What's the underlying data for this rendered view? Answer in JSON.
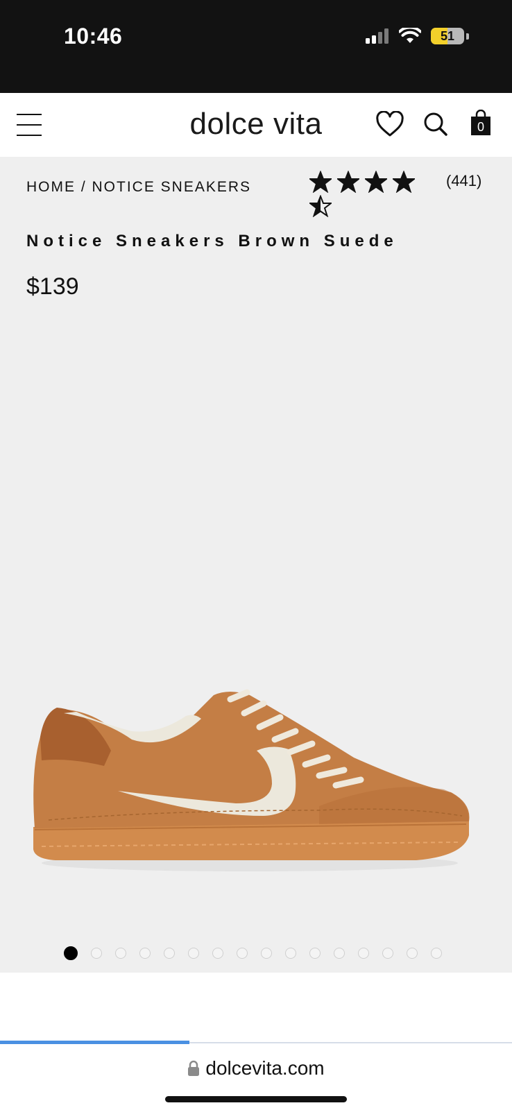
{
  "status_bar": {
    "time": "10:46",
    "battery_level": "51",
    "battery_fraction": 0.51,
    "icons": [
      "signal-icon",
      "wifi-icon",
      "battery-icon"
    ]
  },
  "header": {
    "brand": "dolce vita",
    "cart_count": "0",
    "icons": [
      "menu-icon",
      "heart-icon",
      "search-icon",
      "bag-icon"
    ]
  },
  "product": {
    "breadcrumb": "HOME / NOTICE SNEAKERS",
    "rating": 4.5,
    "rating_max": 5,
    "review_count": "(441)",
    "title": "Notice Sneakers Brown Suede",
    "price": "$139",
    "image_count": 16,
    "active_image_index": 0,
    "colors": {
      "suede": "#c47e45",
      "sole": "#d18a4a",
      "accent": "#ece8dc"
    }
  },
  "browser": {
    "url": "dolcevita.com",
    "load_progress": 0.37,
    "accent_color": "#4a90e2"
  }
}
